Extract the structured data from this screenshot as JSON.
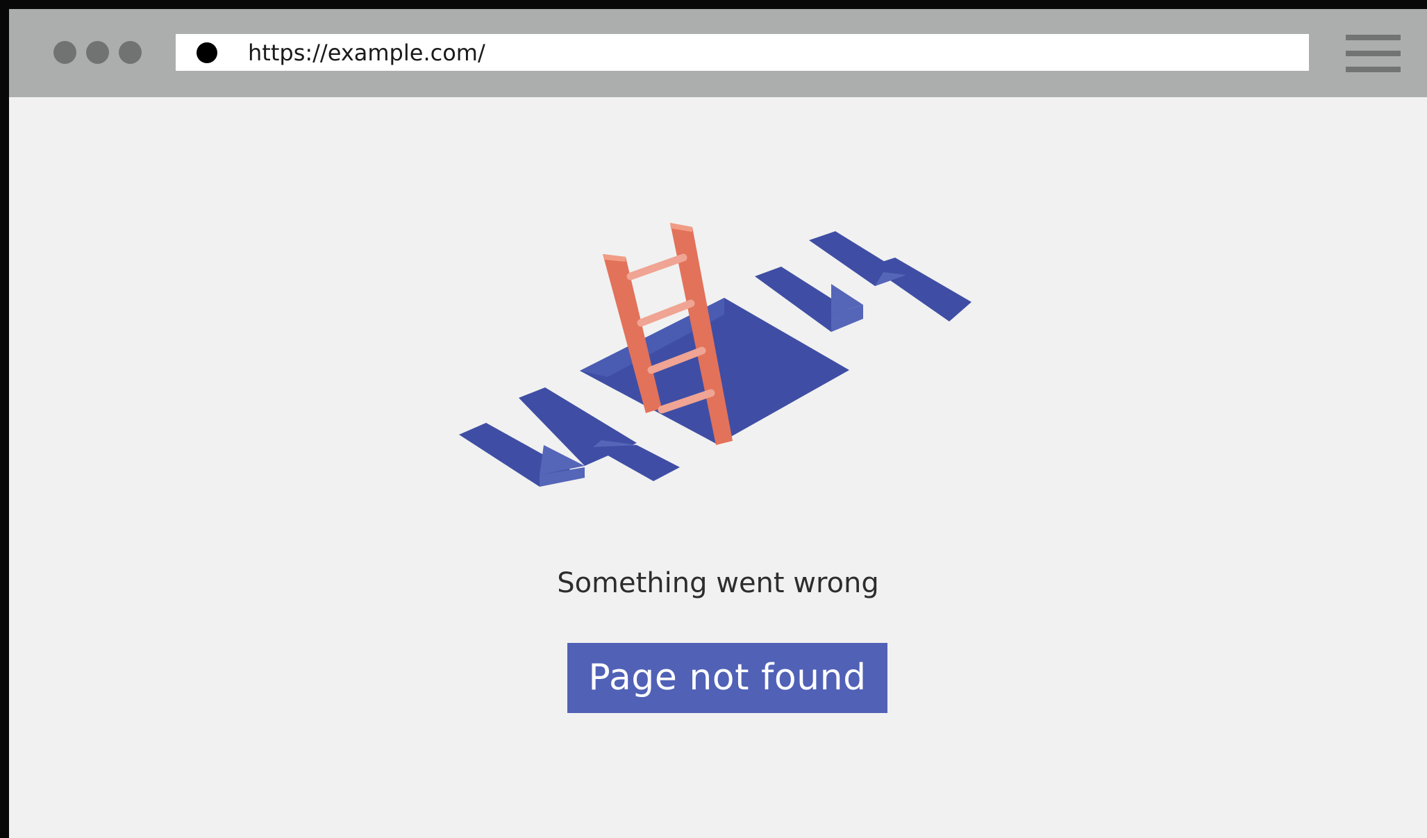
{
  "browser": {
    "url": "https://example.com/"
  },
  "error_page": {
    "message": "Something went wrong",
    "button_label": "Page not found"
  },
  "colors": {
    "frame": "#080808",
    "toolbar": "#acadad",
    "page_background": "#f1f1f1",
    "accent": "#5061b6",
    "hole_blue": "#3f4ea4",
    "ladder": "#e2725a"
  },
  "icons": [
    "window-control-dot-icon",
    "hamburger-menu-icon",
    "404-hole-ladder-illustration"
  ]
}
